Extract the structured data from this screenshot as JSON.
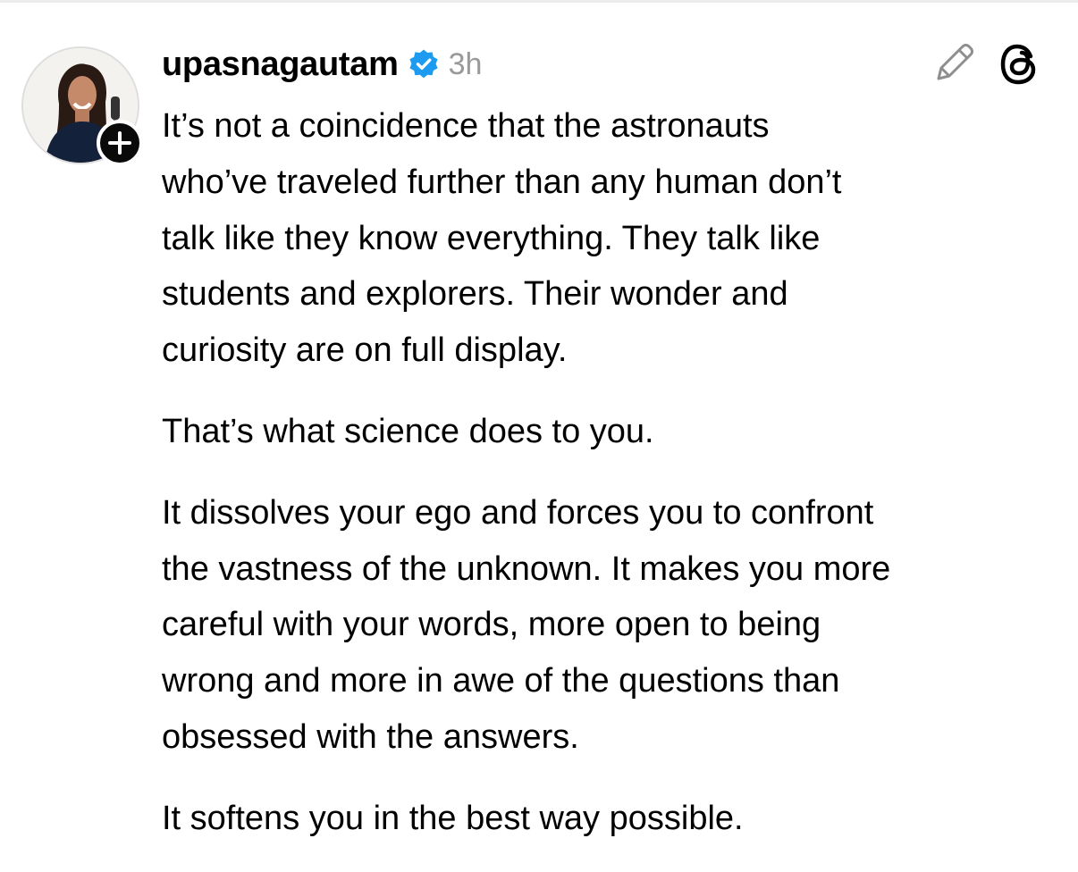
{
  "post": {
    "author": {
      "username": "upasnagautam",
      "verified": true,
      "avatar_icon": "profile-photo",
      "follow_badge": "+"
    },
    "timestamp": "3h",
    "actions": {
      "edit_icon": "pencil-icon",
      "app_icon": "threads-logo-icon"
    },
    "paragraphs": [
      {
        "lines": [
          "It’s not a coincidence that the astronauts",
          "who’ve traveled further than any human don’t",
          "talk like they know everything. They talk like",
          "students and explorers. Their wonder and",
          "curiosity are on full display."
        ]
      },
      {
        "lines": [
          "That’s what science does to you."
        ]
      },
      {
        "lines": [
          "It dissolves your ego and forces you to confront",
          "the vastness of the unknown. It makes you more",
          "careful with your words, more open to being",
          "wrong and more in awe of the questions than",
          "obsessed with the answers."
        ]
      },
      {
        "lines": [
          "It softens you in the best way possible."
        ]
      }
    ]
  },
  "colors": {
    "verified_badge": "#1d9bf0",
    "timestamp": "#999999",
    "text": "#000000",
    "background": "#ffffff"
  }
}
